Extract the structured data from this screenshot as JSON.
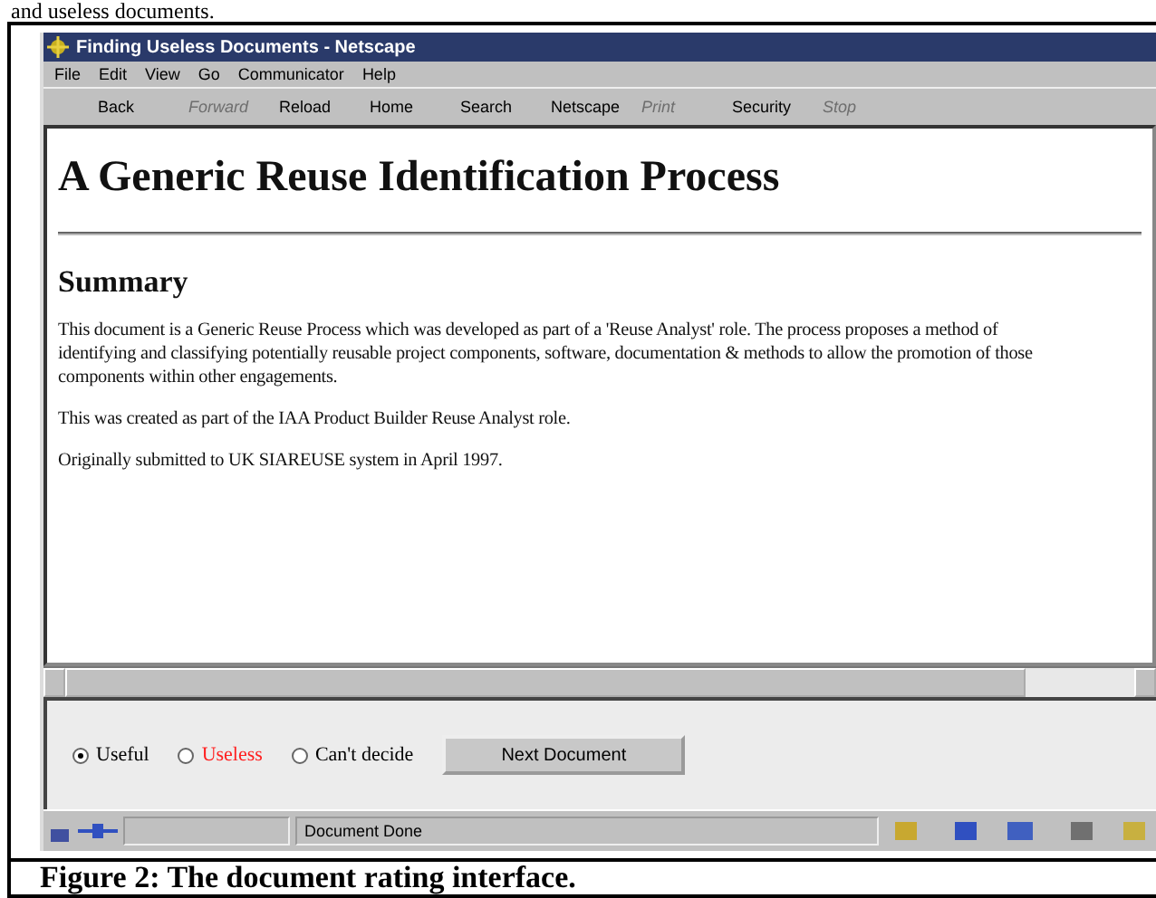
{
  "lead_text": "and useless documents.",
  "window": {
    "title": "Finding Useless Documents - Netscape"
  },
  "menu": [
    "File",
    "Edit",
    "View",
    "Go",
    "Communicator",
    "Help"
  ],
  "toolbar": [
    {
      "label": "Back",
      "disabled": false
    },
    {
      "label": "Forward",
      "disabled": true
    },
    {
      "label": "Reload",
      "disabled": false
    },
    {
      "label": "Home",
      "disabled": false
    },
    {
      "label": "Search",
      "disabled": false
    },
    {
      "label": "Netscape",
      "disabled": false
    },
    {
      "label": "Print",
      "disabled": true
    },
    {
      "label": "Security",
      "disabled": false
    },
    {
      "label": "Stop",
      "disabled": true
    }
  ],
  "page": {
    "heading": "A Generic Reuse Identification Process",
    "subheading": "Summary",
    "paragraphs": [
      "This document is a Generic Reuse Process which was developed as part of a 'Reuse Analyst' role. The process proposes a method of identifying and classifying potentially reusable project components, software, documentation & methods to allow the promotion of those components within other engagements.",
      "This was created as part of the IAA Product Builder Reuse Analyst role.",
      "Originally submitted to UK SIAREUSE system in April 1997."
    ]
  },
  "rating": {
    "options": [
      {
        "label": "Useful",
        "selected": true,
        "color": "#000000"
      },
      {
        "label": "Useless",
        "selected": false,
        "color": "#ff2020"
      },
      {
        "label": "Can't decide",
        "selected": false,
        "color": "#000000"
      }
    ],
    "button": "Next Document"
  },
  "status_bar": {
    "text": "Document Done"
  },
  "caption": "Figure 2:  The document rating interface."
}
